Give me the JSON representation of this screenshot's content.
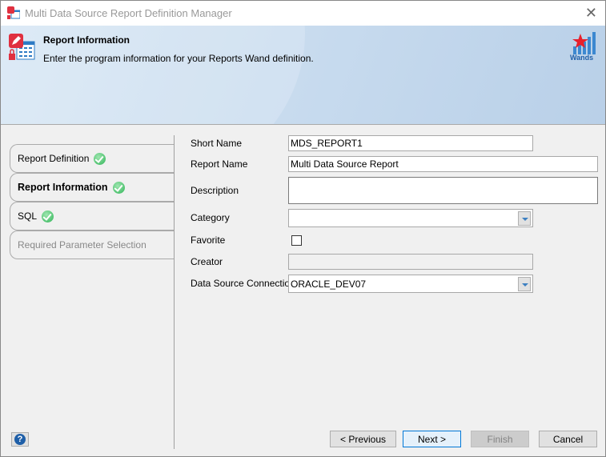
{
  "window": {
    "title": "Multi Data Source Report Definition Manager",
    "close_icon": "close-icon"
  },
  "header": {
    "title": "Report Information",
    "subtitle": "Enter the program information for your Reports Wand definition.",
    "logo_text": "Wands"
  },
  "tabs": [
    {
      "label": "Report Definition",
      "complete": true
    },
    {
      "label": "Report Information",
      "complete": true,
      "active": true
    },
    {
      "label": "SQL",
      "complete": true
    },
    {
      "label": "Required Parameter Selection",
      "complete": false,
      "disabled": true
    }
  ],
  "form": {
    "short_name": {
      "label": "Short Name",
      "value": "MDS_REPORT1"
    },
    "report_name": {
      "label": "Report Name",
      "value": "Multi Data Source Report"
    },
    "description": {
      "label": "Description",
      "value": ""
    },
    "category": {
      "label": "Category",
      "value": ""
    },
    "favorite": {
      "label": "Favorite",
      "checked": false
    },
    "creator": {
      "label": "Creator",
      "value": ""
    },
    "data_source": {
      "label": "Data Source Connection",
      "value": "ORACLE_DEV07"
    }
  },
  "buttons": {
    "previous": "< Previous",
    "next": "Next >",
    "finish": "Finish",
    "cancel": "Cancel",
    "help": "?"
  },
  "colors": {
    "accent": "#0078d7",
    "check": "#2fb457",
    "header": "#c9dcef"
  }
}
